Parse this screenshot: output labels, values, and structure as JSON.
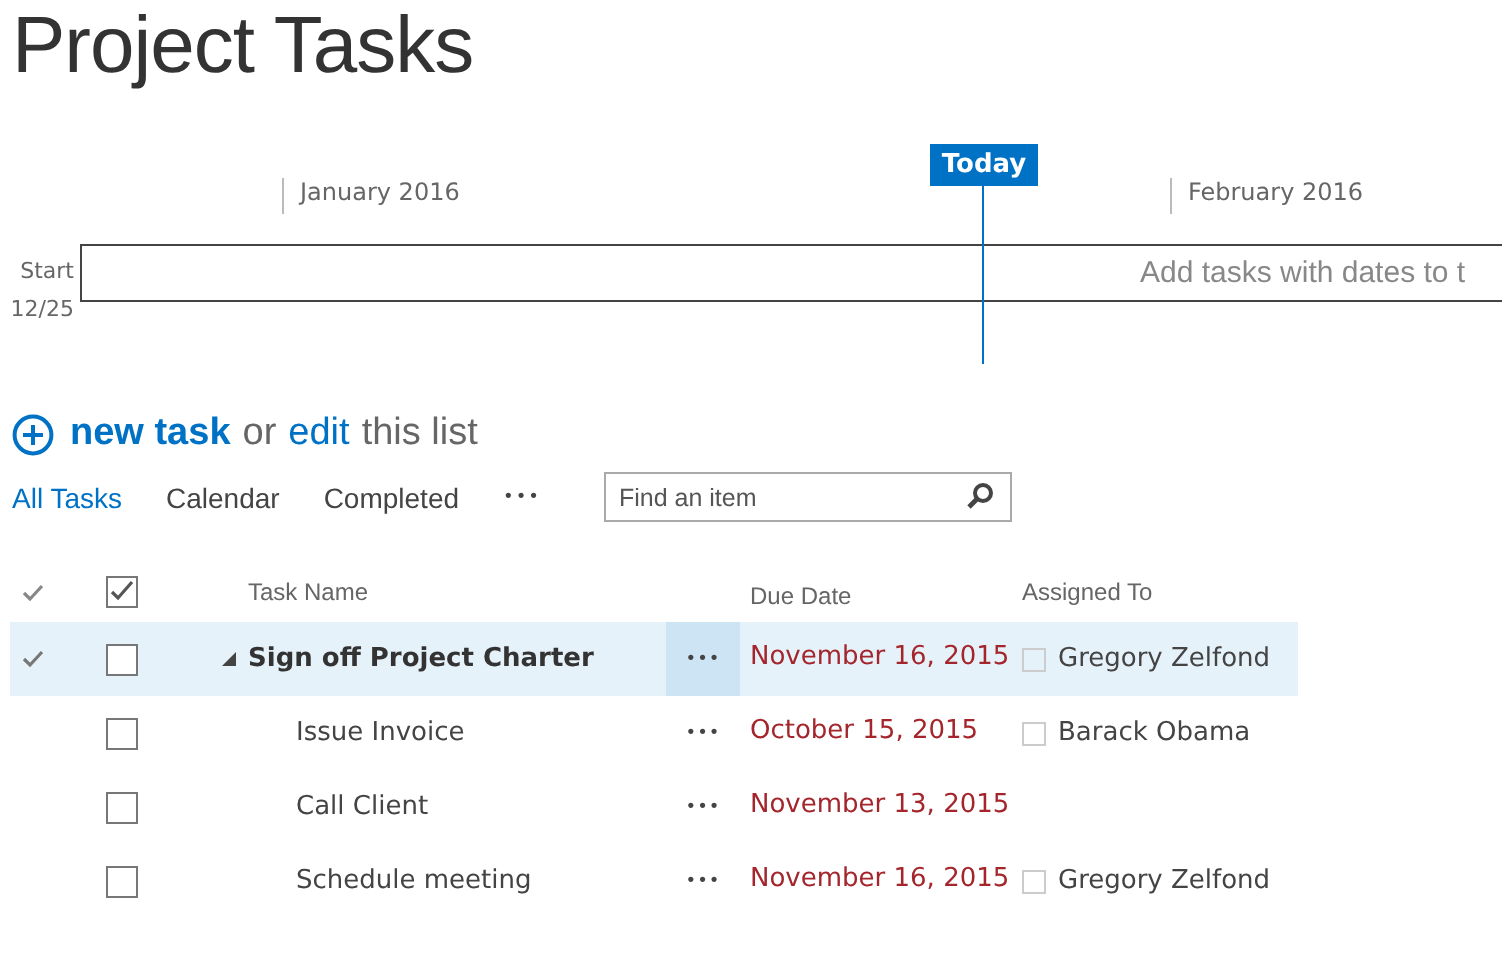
{
  "title": "Project Tasks",
  "timeline": {
    "today_label": "Today",
    "months": [
      "January 2016",
      "February 2016"
    ],
    "start_label": "Start",
    "start_date": "12/25",
    "empty_message": "Add tasks with dates to t"
  },
  "heading": {
    "new_task": "new task",
    "or": "or",
    "edit": "edit",
    "rest": "this list"
  },
  "views": [
    {
      "label": "All Tasks",
      "selected": true
    },
    {
      "label": "Calendar",
      "selected": false
    },
    {
      "label": "Completed",
      "selected": false
    }
  ],
  "more_views": "•••",
  "search": {
    "placeholder": "Find an item"
  },
  "select_all": {
    "checked": true
  },
  "columns": {
    "task_name": "Task Name",
    "due_date": "Due Date",
    "assigned_to": "Assigned To"
  },
  "tasks": [
    {
      "name": "Sign off Project Charter",
      "due": "November 16, 2015",
      "assigned": "Gregory Zelfond",
      "selected": true,
      "checked": false,
      "expanded": true,
      "menu": "•••",
      "children": [
        {
          "name": "Issue Invoice",
          "due": "October 15, 2015",
          "assigned": "Barack Obama",
          "selected": false,
          "checked": false,
          "menu": "•••"
        },
        {
          "name": "Call Client",
          "due": "November 13, 2015",
          "selected": false,
          "checked": false,
          "menu": "•••"
        },
        {
          "name": "Schedule meeting",
          "due": "November 16, 2015",
          "assigned": "Gregory Zelfond",
          "selected": false,
          "checked": false,
          "menu": "•••"
        }
      ]
    }
  ]
}
